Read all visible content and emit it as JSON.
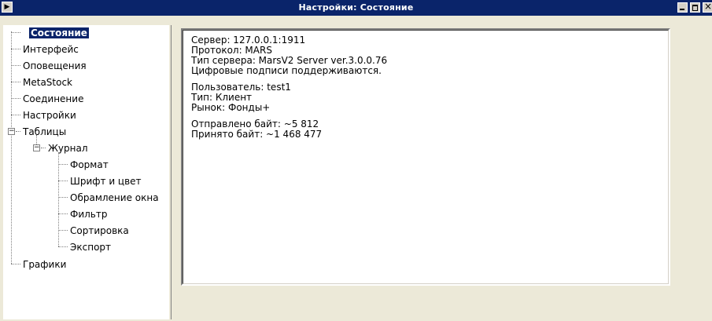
{
  "window": {
    "title": "Настройки: Состояние"
  },
  "tree": {
    "items": [
      {
        "label": "Состояние",
        "selected": true
      },
      {
        "label": "Интерфейс"
      },
      {
        "label": "Оповещения"
      },
      {
        "label": "MetaStock"
      },
      {
        "label": "Соединение"
      },
      {
        "label": "Настройки"
      },
      {
        "label": "Таблицы",
        "expanded": true
      },
      {
        "label": "Журнал",
        "expanded": true
      },
      {
        "label": "Формат"
      },
      {
        "label": "Шрифт и цвет"
      },
      {
        "label": "Обрамление окна"
      },
      {
        "label": "Фильтр"
      },
      {
        "label": "Сортировка"
      },
      {
        "label": "Экспорт"
      },
      {
        "label": "Графики"
      }
    ],
    "expander_symbol": "−"
  },
  "status": {
    "server": "Сервер: 127.0.0.1:1911",
    "protocol": "Протокол: MARS",
    "server_type": "Тип сервера: MarsV2 Server ver.3.0.0.76",
    "signatures": "Цифровые подписи поддерживаются.",
    "user": "Пользователь: test1",
    "type": "Тип: Клиент",
    "market": "Рынок: Фонды+",
    "sent": "Отправлено байт: ~5 812",
    "received": "Принято байт: ~1 468 477"
  }
}
